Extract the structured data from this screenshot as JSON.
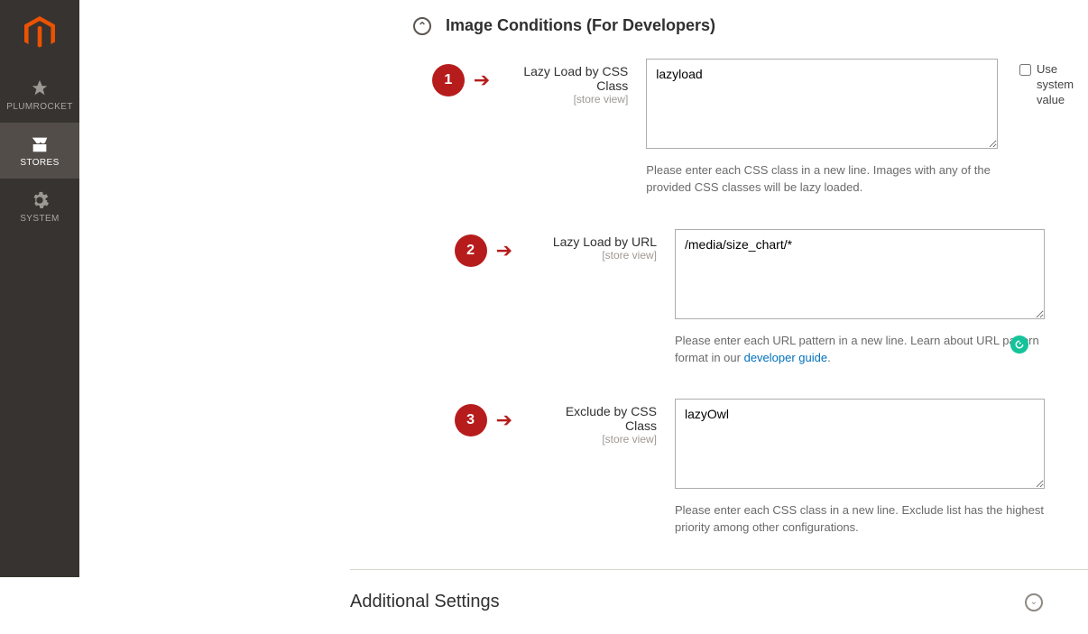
{
  "sidebar": {
    "items": [
      {
        "id": "plumrocket",
        "label": "PLUMROCKET"
      },
      {
        "id": "stores",
        "label": "STORES"
      },
      {
        "id": "system",
        "label": "SYSTEM"
      }
    ],
    "active": "stores"
  },
  "section": {
    "title": "Image Conditions (For Developers)"
  },
  "rows": [
    {
      "bubble": "1",
      "label": "Lazy Load by CSS Class",
      "scope": "[store view]",
      "value": "lazyload",
      "hint": "Please enter each CSS class in a new line. Images with any of the provided CSS classes will be lazy loaded.",
      "use_system_value_label": "Use system value",
      "show_system_checkbox": true,
      "show_grammarly": false
    },
    {
      "bubble": "2",
      "label": "Lazy Load by URL",
      "scope": "[store view]",
      "value": "/media/size_chart/*",
      "hint_pre": "Please enter each URL pattern in a new line. Learn about URL pattern format in our ",
      "hint_link": "developer guide",
      "hint_post": ".",
      "show_system_checkbox": false,
      "show_grammarly": true
    },
    {
      "bubble": "3",
      "label": "Exclude by CSS Class",
      "scope": "[store view]",
      "value": "lazyOwl",
      "hint": "Please enter each CSS class in a new line. Exclude list has the highest priority among other configurations.",
      "show_system_checkbox": false,
      "show_grammarly": false
    }
  ],
  "additional_settings": {
    "title": "Additional Settings"
  }
}
